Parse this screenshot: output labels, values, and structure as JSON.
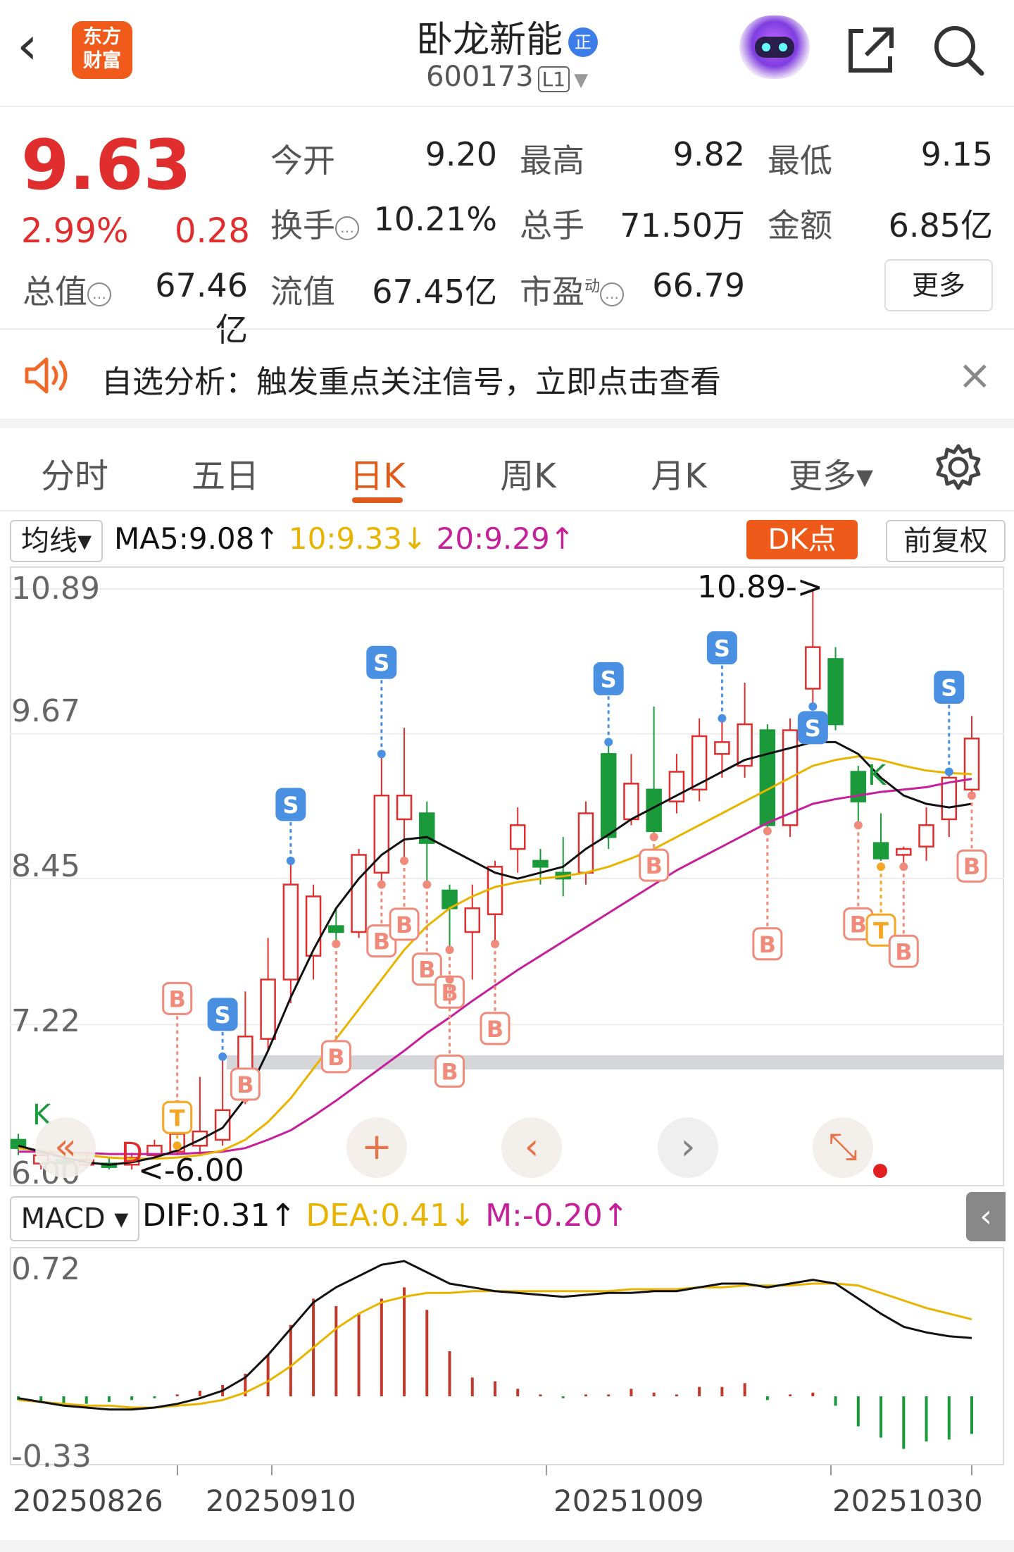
{
  "header": {
    "back_glyph": "‹",
    "logo_line1": "东方",
    "logo_line2": "财富",
    "stock_name": "卧龙新能",
    "cert_badge": "正",
    "stock_code": "600173",
    "level_tag": "L1",
    "icons": [
      "back-icon",
      "robot-avatar-icon",
      "share-icon",
      "search-icon"
    ]
  },
  "quote": {
    "price": "9.63",
    "change_pct": "2.99%",
    "change_amt": "0.28",
    "stats": {
      "open_label": "今开",
      "open": "9.20",
      "high_label": "最高",
      "high": "9.82",
      "low_label": "最低",
      "low": "9.15",
      "turnover_label": "换手",
      "turnover": "10.21%",
      "volume_label": "总手",
      "volume": "71.50万",
      "amount_label": "金额",
      "amount": "6.85亿",
      "mktcap_label": "总值",
      "mktcap": "67.46亿",
      "float_label": "流值",
      "float_cap": "67.45亿",
      "pe_label": "市盈",
      "pe_sup": "动",
      "pe": "66.79"
    },
    "more_label": "更多"
  },
  "notice": {
    "text": "自选分析：触发重点关注信号，立即点击查看",
    "close_glyph": "×"
  },
  "tabs": [
    {
      "label": "分时",
      "active": false
    },
    {
      "label": "五日",
      "active": false
    },
    {
      "label": "日K",
      "active": true
    },
    {
      "label": "周K",
      "active": false
    },
    {
      "label": "月K",
      "active": false
    },
    {
      "label": "更多▾",
      "active": false
    }
  ],
  "indicators": {
    "ma_select": "均线▾",
    "ma5": "MA5:9.08↑",
    "ma10": "10:9.33↓",
    "ma20": "20:9.29↑",
    "dk_label": "DK点",
    "adjust_label": "前复权"
  },
  "colors": {
    "up": "#e02d2d",
    "down": "#1a9a3a",
    "ma5": "#111111",
    "ma10": "#e8b400",
    "ma20": "#c51f9a",
    "accent": "#e05a1a",
    "s_signal": "#4a90e2",
    "b_signal": "#f08a7a",
    "t_signal": "#f5a623"
  },
  "kline": {
    "y_labels": [
      "10.89",
      "9.67",
      "8.45",
      "7.22",
      "6.00"
    ],
    "max_label": "10.89->",
    "min_label": "<-6.00",
    "markers": {
      "s": "S",
      "b": "B",
      "t": "T",
      "k": "K",
      "d": "D"
    },
    "chart_data": {
      "type": "candlestick",
      "ylim": [
        6.0,
        10.89
      ],
      "candles": [
        {
          "o": 6.25,
          "c": 6.18,
          "h": 6.3,
          "l": 6.12,
          "up": false
        },
        {
          "o": 6.05,
          "c": 6.12,
          "h": 6.15,
          "l": 6.0,
          "up": true
        },
        {
          "o": 6.08,
          "c": 6.05,
          "h": 6.12,
          "l": 6.02,
          "up": false
        },
        {
          "o": 6.04,
          "c": 6.08,
          "h": 6.12,
          "l": 6.01,
          "up": true
        },
        {
          "o": 6.05,
          "c": 6.02,
          "h": 6.1,
          "l": 6.0,
          "up": false
        },
        {
          "o": 6.04,
          "c": 6.1,
          "h": 6.14,
          "l": 6.0,
          "up": true
        },
        {
          "o": 6.12,
          "c": 6.2,
          "h": 6.25,
          "l": 6.1,
          "up": true
        },
        {
          "o": 6.15,
          "c": 6.3,
          "h": 6.55,
          "l": 6.12,
          "up": true
        },
        {
          "o": 6.2,
          "c": 6.32,
          "h": 6.78,
          "l": 6.12,
          "up": true
        },
        {
          "o": 6.25,
          "c": 6.5,
          "h": 6.95,
          "l": 6.2,
          "up": true
        },
        {
          "o": 6.6,
          "c": 7.12,
          "h": 7.5,
          "l": 6.55,
          "up": true
        },
        {
          "o": 7.1,
          "c": 7.6,
          "h": 7.95,
          "l": 7.0,
          "up": true
        },
        {
          "o": 7.6,
          "c": 8.4,
          "h": 8.6,
          "l": 7.4,
          "up": true
        },
        {
          "o": 7.8,
          "c": 8.3,
          "h": 8.4,
          "l": 7.6,
          "up": true
        },
        {
          "o": 8.0,
          "c": 8.05,
          "h": 8.2,
          "l": 7.9,
          "up": false
        },
        {
          "o": 8.0,
          "c": 8.65,
          "h": 8.7,
          "l": 7.95,
          "up": true
        },
        {
          "o": 8.5,
          "c": 9.15,
          "h": 9.5,
          "l": 8.4,
          "up": true
        },
        {
          "o": 8.95,
          "c": 9.15,
          "h": 9.72,
          "l": 8.6,
          "up": true
        },
        {
          "o": 9.0,
          "c": 8.75,
          "h": 9.1,
          "l": 8.4,
          "up": false
        },
        {
          "o": 8.35,
          "c": 8.2,
          "h": 8.4,
          "l": 7.85,
          "up": false
        },
        {
          "o": 8.0,
          "c": 8.2,
          "h": 8.4,
          "l": 7.6,
          "up": true
        },
        {
          "o": 8.15,
          "c": 8.55,
          "h": 8.6,
          "l": 7.9,
          "up": true
        },
        {
          "o": 8.7,
          "c": 8.9,
          "h": 9.05,
          "l": 8.5,
          "up": true
        },
        {
          "o": 8.6,
          "c": 8.55,
          "h": 8.7,
          "l": 8.4,
          "up": false
        },
        {
          "o": 8.5,
          "c": 8.45,
          "h": 8.8,
          "l": 8.3,
          "up": false
        },
        {
          "o": 8.5,
          "c": 9.0,
          "h": 9.1,
          "l": 8.4,
          "up": true
        },
        {
          "o": 9.5,
          "c": 8.8,
          "h": 9.6,
          "l": 8.7,
          "up": false
        },
        {
          "o": 8.95,
          "c": 9.25,
          "h": 9.5,
          "l": 8.9,
          "up": true
        },
        {
          "o": 9.2,
          "c": 8.85,
          "h": 9.9,
          "l": 8.8,
          "up": false
        },
        {
          "o": 9.1,
          "c": 9.35,
          "h": 9.5,
          "l": 9.0,
          "up": true
        },
        {
          "o": 9.2,
          "c": 9.65,
          "h": 9.8,
          "l": 9.1,
          "up": true
        },
        {
          "o": 9.5,
          "c": 9.6,
          "h": 9.8,
          "l": 9.3,
          "up": true
        },
        {
          "o": 9.4,
          "c": 9.75,
          "h": 10.1,
          "l": 9.3,
          "up": true
        },
        {
          "o": 9.7,
          "c": 8.9,
          "h": 9.75,
          "l": 8.85,
          "up": false
        },
        {
          "o": 8.9,
          "c": 9.7,
          "h": 9.8,
          "l": 8.8,
          "up": true
        },
        {
          "o": 10.05,
          "c": 10.4,
          "h": 10.89,
          "l": 9.9,
          "up": true
        },
        {
          "o": 10.3,
          "c": 9.75,
          "h": 10.4,
          "l": 9.7,
          "up": false
        },
        {
          "o": 9.35,
          "c": 9.1,
          "h": 9.4,
          "l": 8.9,
          "up": false
        },
        {
          "o": 8.75,
          "c": 8.62,
          "h": 9.0,
          "l": 8.6,
          "up": false
        },
        {
          "o": 8.7,
          "c": 8.65,
          "h": 8.72,
          "l": 8.55,
          "up": true
        },
        {
          "o": 8.72,
          "c": 8.9,
          "h": 9.05,
          "l": 8.6,
          "up": true
        },
        {
          "o": 8.95,
          "c": 9.3,
          "h": 9.35,
          "l": 8.8,
          "up": true
        },
        {
          "o": 9.2,
          "c": 9.63,
          "h": 9.82,
          "l": 9.15,
          "up": true
        }
      ],
      "ma5": [
        6.2,
        6.15,
        6.1,
        6.06,
        6.04,
        6.06,
        6.1,
        6.16,
        6.25,
        6.35,
        6.6,
        7.0,
        7.45,
        7.85,
        8.2,
        8.45,
        8.65,
        8.78,
        8.8,
        8.7,
        8.6,
        8.5,
        8.45,
        8.5,
        8.55,
        8.7,
        8.82,
        8.95,
        9.05,
        9.15,
        9.25,
        9.35,
        9.45,
        9.5,
        9.55,
        9.6,
        9.6,
        9.5,
        9.3,
        9.15,
        9.08,
        9.05,
        9.08
      ],
      "ma10": [
        6.18,
        6.16,
        6.14,
        6.12,
        6.1,
        6.09,
        6.09,
        6.1,
        6.12,
        6.16,
        6.25,
        6.4,
        6.6,
        6.85,
        7.1,
        7.35,
        7.6,
        7.85,
        8.05,
        8.2,
        8.3,
        8.38,
        8.42,
        8.45,
        8.47,
        8.5,
        8.55,
        8.62,
        8.7,
        8.8,
        8.9,
        9.0,
        9.1,
        9.2,
        9.3,
        9.4,
        9.45,
        9.48,
        9.45,
        9.4,
        9.36,
        9.34,
        9.33
      ],
      "ma20": [
        6.15,
        6.15,
        6.14,
        6.14,
        6.13,
        6.13,
        6.13,
        6.13,
        6.14,
        6.15,
        6.18,
        6.25,
        6.33,
        6.45,
        6.58,
        6.72,
        6.86,
        7.0,
        7.15,
        7.28,
        7.42,
        7.55,
        7.68,
        7.8,
        7.92,
        8.04,
        8.16,
        8.28,
        8.4,
        8.52,
        8.62,
        8.72,
        8.82,
        8.92,
        9.0,
        9.08,
        9.12,
        9.15,
        9.18,
        9.2,
        9.22,
        9.26,
        9.29
      ]
    }
  },
  "controls": [
    "«",
    "+",
    "‹",
    "›",
    "⤡"
  ],
  "macd": {
    "select_label": "MACD ▾",
    "dif": "DIF:0.31↑",
    "dea": "DEA:0.41↓",
    "m": "M:-0.20↑",
    "y_labels": [
      "0.72",
      "-0.33"
    ],
    "collapse_glyph": "‹",
    "chart_data": {
      "type": "bar+line",
      "ylim": [
        -0.33,
        0.72
      ],
      "m": [
        -0.02,
        -0.03,
        -0.04,
        -0.04,
        -0.03,
        -0.02,
        -0.01,
        0.01,
        0.03,
        0.06,
        0.12,
        0.22,
        0.38,
        0.52,
        0.48,
        0.44,
        0.52,
        0.58,
        0.46,
        0.24,
        0.1,
        0.08,
        0.04,
        0.01,
        -0.01,
        0.01,
        0.01,
        0.04,
        0.02,
        0.01,
        0.05,
        0.05,
        0.07,
        -0.02,
        0.01,
        0.02,
        -0.05,
        -0.16,
        -0.22,
        -0.28,
        -0.24,
        -0.23,
        -0.2
      ],
      "dif": [
        -0.01,
        -0.03,
        -0.05,
        -0.06,
        -0.07,
        -0.07,
        -0.06,
        -0.04,
        -0.01,
        0.03,
        0.1,
        0.22,
        0.36,
        0.5,
        0.58,
        0.64,
        0.7,
        0.72,
        0.66,
        0.6,
        0.58,
        0.56,
        0.55,
        0.54,
        0.53,
        0.54,
        0.55,
        0.55,
        0.56,
        0.56,
        0.58,
        0.6,
        0.6,
        0.58,
        0.6,
        0.62,
        0.6,
        0.52,
        0.44,
        0.37,
        0.34,
        0.32,
        0.31
      ],
      "dea": [
        -0.02,
        -0.03,
        -0.04,
        -0.05,
        -0.05,
        -0.06,
        -0.06,
        -0.05,
        -0.04,
        -0.02,
        0.02,
        0.08,
        0.16,
        0.26,
        0.36,
        0.44,
        0.5,
        0.53,
        0.55,
        0.55,
        0.56,
        0.56,
        0.56,
        0.56,
        0.56,
        0.56,
        0.56,
        0.57,
        0.57,
        0.57,
        0.58,
        0.58,
        0.59,
        0.59,
        0.59,
        0.6,
        0.6,
        0.59,
        0.55,
        0.51,
        0.47,
        0.44,
        0.41
      ]
    }
  },
  "x_axis": {
    "dates": [
      "20250826",
      "20250910",
      "20251009",
      "20251030"
    ]
  }
}
